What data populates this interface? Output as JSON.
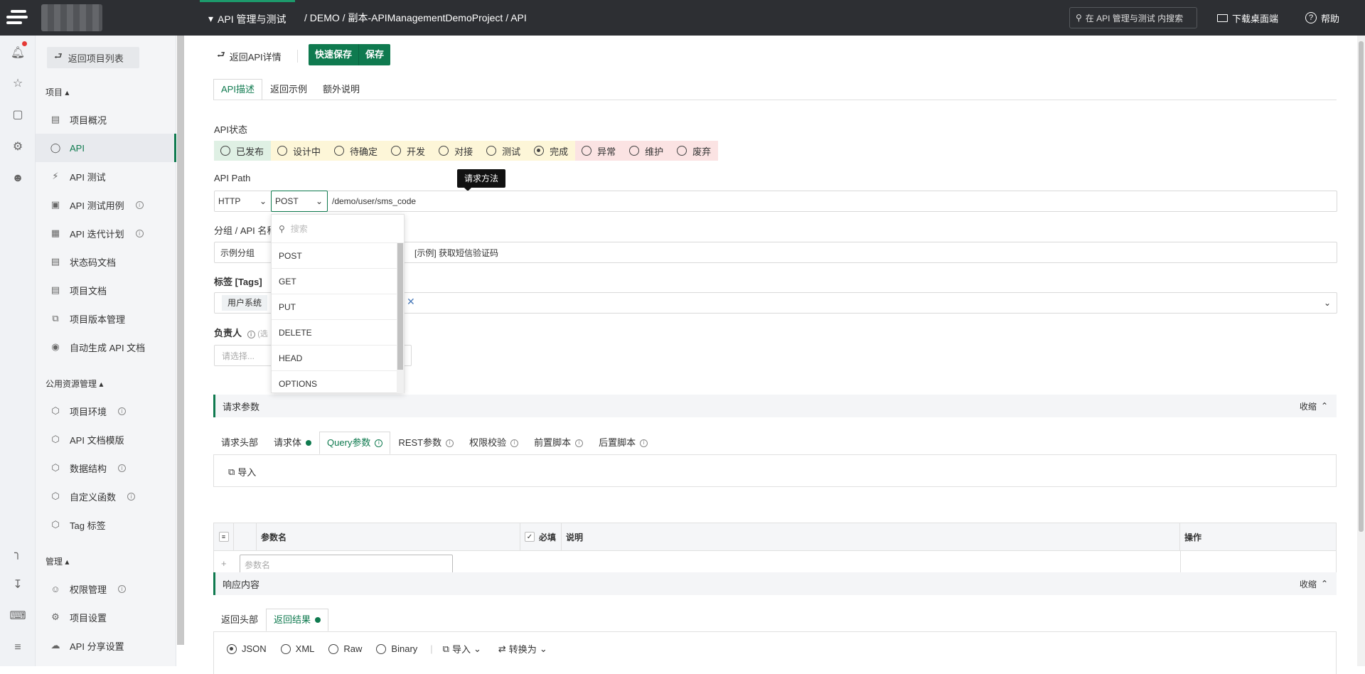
{
  "topbar": {
    "module": "API 管理与测试",
    "breadcrumb": "/ DEMO / 副本-APIManagementDemoProject / API",
    "search_placeholder": "在 API 管理与测试 内搜索",
    "download": "下载桌面端",
    "help": "帮助"
  },
  "sidebar": {
    "back": "返回项目列表",
    "section_project": "项目",
    "project_items": [
      {
        "label": "项目概况",
        "icon": "overview-icon"
      },
      {
        "label": "API",
        "icon": "api-icon"
      },
      {
        "label": "API 测试",
        "icon": "test-icon"
      },
      {
        "label": "API 测试用例",
        "icon": "testcase-icon"
      },
      {
        "label": "API 迭代计划",
        "icon": "calendar-icon"
      },
      {
        "label": "状态码文档",
        "icon": "statuscode-icon"
      },
      {
        "label": "项目文档",
        "icon": "doc-icon"
      },
      {
        "label": "项目版本管理",
        "icon": "version-icon"
      },
      {
        "label": "自动生成 API 文档",
        "icon": "robot-icon"
      }
    ],
    "section_public": "公用资源管理",
    "public_items": [
      {
        "label": "项目环境",
        "icon": "cube-icon"
      },
      {
        "label": "API 文档模版",
        "icon": "cube-icon"
      },
      {
        "label": "数据结构",
        "icon": "cube-icon"
      },
      {
        "label": "自定义函数",
        "icon": "cube-icon"
      },
      {
        "label": "Tag 标签",
        "icon": "cube-icon"
      }
    ],
    "section_manage": "管理",
    "manage_items": [
      {
        "label": "权限管理",
        "icon": "user-icon"
      },
      {
        "label": "项目设置",
        "icon": "gear-icon"
      },
      {
        "label": "API 分享设置",
        "icon": "cloud-icon"
      }
    ]
  },
  "toolbar": {
    "back": "返回API详情",
    "quick_save": "快速保存",
    "save": "保存"
  },
  "tabs": [
    "API描述",
    "返回示例",
    "额外说明"
  ],
  "status": {
    "label": "API状态",
    "options": [
      {
        "label": "已发布",
        "bg": "#dff0e4",
        "checked": false
      },
      {
        "label": "设计中",
        "bg": "#fdf6d8",
        "checked": false
      },
      {
        "label": "待确定",
        "bg": "#fdf6d8",
        "checked": false
      },
      {
        "label": "开发",
        "bg": "#fdf6d8",
        "checked": false
      },
      {
        "label": "对接",
        "bg": "#fdf6d8",
        "checked": false
      },
      {
        "label": "测试",
        "bg": "#fdf6d8",
        "checked": false
      },
      {
        "label": "完成",
        "bg": "#fdf6d8",
        "checked": true
      },
      {
        "label": "异常",
        "bg": "#fbe3e3",
        "checked": false
      },
      {
        "label": "维护",
        "bg": "#fbe3e3",
        "checked": false
      },
      {
        "label": "废弃",
        "bg": "#fbe3e3",
        "checked": false
      }
    ]
  },
  "path": {
    "label": "API Path",
    "protocol": "HTTP",
    "method": "POST",
    "url": "/demo/user/sms_code",
    "tooltip": "请求方法"
  },
  "method_dropdown": {
    "search_placeholder": "搜索",
    "options": [
      "POST",
      "GET",
      "PUT",
      "DELETE",
      "HEAD",
      "OPTIONS"
    ]
  },
  "group": {
    "label": "分组 / API 名称",
    "group_value": "示例分组",
    "name_value": "[示例] 获取短信验证码"
  },
  "tags": {
    "label": "标签 [Tags]",
    "values": [
      "用户系统"
    ]
  },
  "owner": {
    "label": "负责人",
    "hint": "(选",
    "placeholder": "请选择..."
  },
  "request": {
    "title": "请求参数",
    "collapse": "收缩",
    "tabs": [
      "请求头部",
      "请求体",
      "Query参数",
      "REST参数",
      "权限校验",
      "前置脚本",
      "后置脚本"
    ],
    "import": "导入",
    "columns": {
      "name": "参数名",
      "required": "必填",
      "desc": "说明",
      "ops": "操作"
    },
    "param_placeholder": "参数名"
  },
  "response": {
    "title": "响应内容",
    "collapse": "收缩",
    "tabs": [
      "返回头部",
      "返回结果"
    ],
    "formats": [
      "JSON",
      "XML",
      "Raw",
      "Binary"
    ],
    "import": "导入",
    "convert": "转换为"
  },
  "colors": {
    "accent": "#0f7a4f",
    "topbar": "#2d2f33"
  }
}
